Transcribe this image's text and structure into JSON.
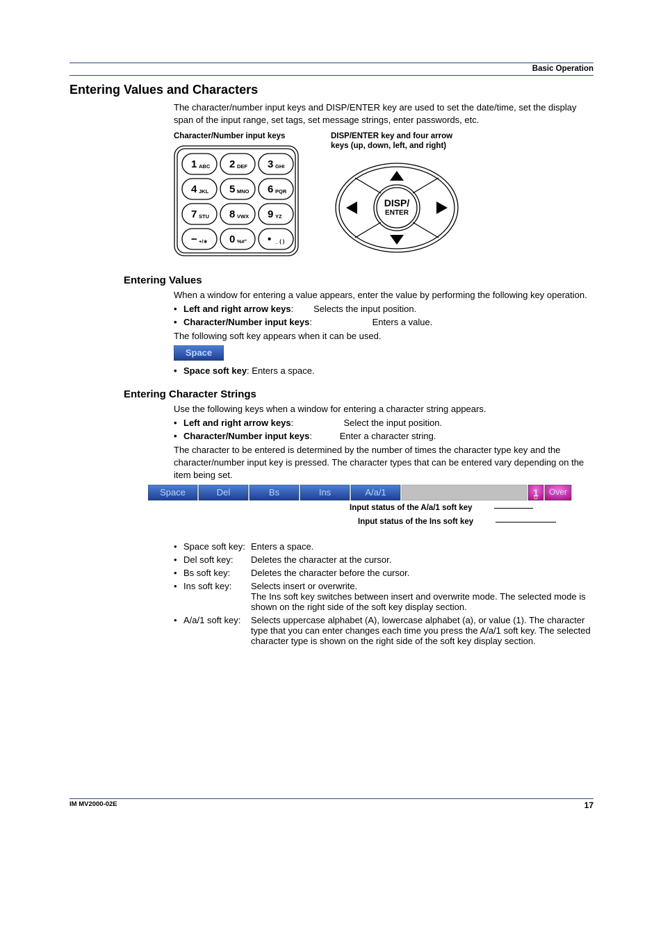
{
  "header": {
    "section": "Basic Operation"
  },
  "h1": "Entering Values and Characters",
  "intro": "The character/number input keys and DISP/ENTER key are used to set the date/time, set the display span of the input range, set tags, set message strings, enter passwords, etc.",
  "keypad": {
    "label_left": "Character/Number input keys",
    "label_right1": "DISP/ENTER key and four arrow",
    "label_right2": "keys (up, down, left, and right)",
    "keys": [
      [
        {
          "d": "1",
          "s": "ABC"
        },
        {
          "d": "2",
          "s": "DEF"
        },
        {
          "d": "3",
          "s": "GHI"
        }
      ],
      [
        {
          "d": "4",
          "s": "JKL"
        },
        {
          "d": "5",
          "s": "MNO"
        },
        {
          "d": "6",
          "s": "PQR"
        }
      ],
      [
        {
          "d": "7",
          "s": "STU"
        },
        {
          "d": "8",
          "s": "VWX"
        },
        {
          "d": "9",
          "s": "YZ"
        }
      ],
      [
        {
          "d": "−",
          "s": "+/∗"
        },
        {
          "d": "0",
          "s": "%#°"
        },
        {
          "d": "•",
          "s": "_ ( )"
        }
      ]
    ],
    "disp": "DISP/",
    "enter": "ENTER"
  },
  "values": {
    "heading": "Entering Values",
    "intro": "When a window for entering a value appears, enter the value by performing the following key operation.",
    "li1_label": "Left and right arrow keys",
    "li1_desc": "Selects the input position.",
    "li2_label": "Character/Number input keys",
    "li2_desc": "Enters a value.",
    "note": "The following soft key appears when it can be used.",
    "space_key": "Space",
    "li3_label": "Space soft key",
    "li3_desc": "Enters a space."
  },
  "strings": {
    "heading": "Entering Character Strings",
    "intro": "Use the following keys when a window for entering a character string appears.",
    "li1_label": "Left and right arrow keys",
    "li1_desc": "Select the input position.",
    "li2_label": "Character/Number input keys",
    "li2_desc": "Enter a character string.",
    "note": "The character to be entered is determined by the number of times the character type key and the character/number input key is pressed. The character types that can be entered vary depending on the item being set.",
    "softkeys": [
      "Space",
      "Del",
      "Bs",
      "Ins",
      "A/a/1"
    ],
    "status_mode": "1",
    "status_over": "Over",
    "callout1": "Input status of the A/a/1 soft key",
    "callout2": "Input status of the Ins soft key",
    "desc": [
      {
        "label": "Space soft key:",
        "val": "Enters a space."
      },
      {
        "label": "Del soft key:",
        "val": "Deletes the character at the cursor."
      },
      {
        "label": "Bs soft key:",
        "val": "Deletes the character before the cursor."
      },
      {
        "label": "Ins soft key:",
        "val": "Selects insert or overwrite.\nThe Ins soft key switches between insert and overwrite mode. The selected mode is shown on the right side of the soft key display section."
      },
      {
        "label": "A/a/1 soft key:",
        "val": "Selects uppercase alphabet (A), lowercase alphabet (a), or value (1). The character type that you can enter changes each time you press the A/a/1 soft key. The selected character type is shown on the right side of the soft key display section."
      }
    ]
  },
  "footer": {
    "doc": "IM MV2000-02E",
    "page": "17"
  }
}
